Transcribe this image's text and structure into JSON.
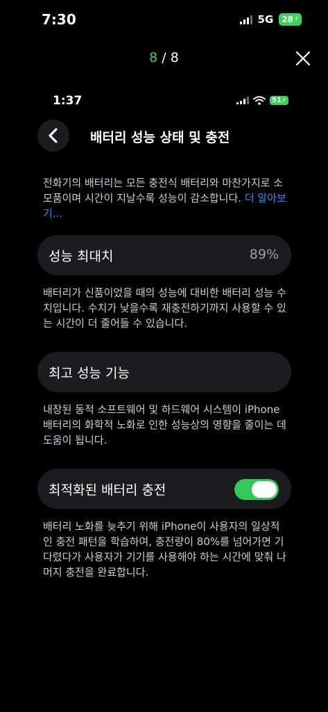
{
  "outer_status": {
    "time": "7:30",
    "network": "5G",
    "battery": "28"
  },
  "viewer": {
    "current": "8",
    "separator": " / ",
    "total": "8",
    "close_icon": "close-icon"
  },
  "inner_status": {
    "time": "1:37",
    "battery": "51"
  },
  "nav": {
    "title": "배터리 성능 상태 및 충전",
    "back_icon": "chevron-left-icon"
  },
  "intro": {
    "text": "전화기의 배터리는 모든 충전식 배터리와 마찬가지로 소모품이며 시간이 지날수록 성능이 감소합니다. ",
    "link": "더 알아보기..."
  },
  "max_capacity": {
    "label": "성능 최대치",
    "value": "89%",
    "description": "배터리가 신품이었을 때의 성능에 대비한 배터리 성능 수치입니다. 수치가 낮을수록 재충전하기까지 사용할 수 있는 시간이 더 줄어들 수 있습니다."
  },
  "peak_performance": {
    "label": "최고 성능 기능",
    "description": "내장된 동적 소프트웨어 및 하드웨어 시스템이 iPhone 배터리의 화학적 노화로 인한 성능상의 영향을 줄이는 데 도움이 됩니다."
  },
  "optimized_charging": {
    "label": "최적화된 배터리 충전",
    "enabled": true,
    "description": "배터리 노화를 늦추기 위해 iPhone이 사용자의 일상적인 충전 패턴을 학습하여, 충전량이 80%를 넘어가면 기다렸다가 사용자가 기기를 사용해야 하는 시간에 맞춰 나머지 충전을 완료합니다."
  },
  "colors": {
    "accent_green": "#3fd15a",
    "toggle_on": "#34c759",
    "link_blue": "#3a8bff",
    "cell_bg": "#1c1c1e"
  }
}
